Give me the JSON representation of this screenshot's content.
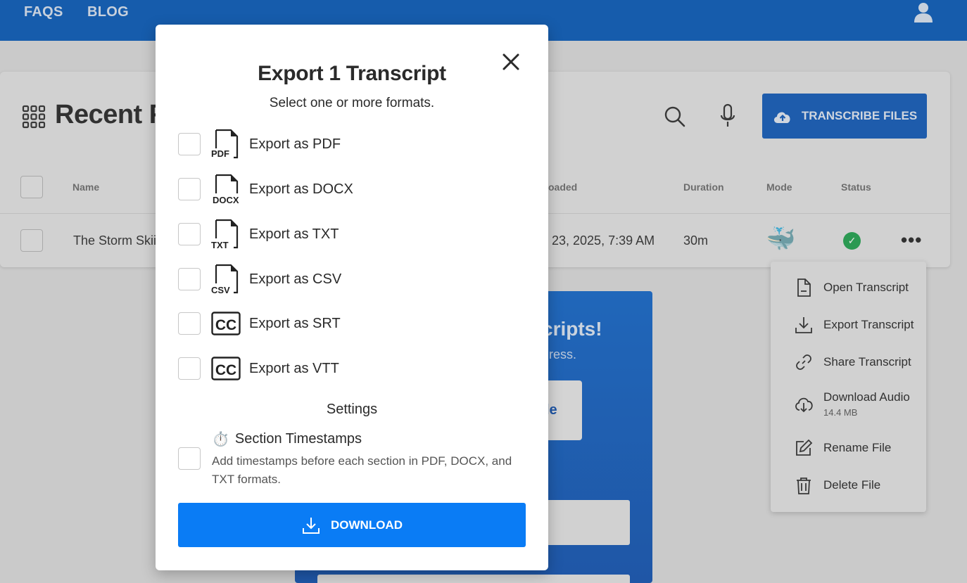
{
  "nav": {
    "faqs": "FAQS",
    "blog": "BLOG"
  },
  "background": {
    "recent_title": "Recent Fi",
    "transcribe_label": "TRANSCRIBE FILES",
    "columns": {
      "name": "Name",
      "uploaded": "oaded",
      "duration": "Duration",
      "mode": "Mode",
      "status": "Status"
    },
    "row": {
      "name": "The Storm Skiii",
      "uploaded": "23, 2025, 7:39 AM",
      "duration": "30m",
      "mode_icon": "🐳",
      "status_icon": "✓",
      "more": "•••"
    },
    "promo": {
      "title": "cripts!",
      "subtitle": "gress.",
      "button": "le"
    }
  },
  "context_menu": {
    "items": [
      {
        "label": "Open Transcript",
        "icon": "document-icon"
      },
      {
        "label": "Export Transcript",
        "icon": "download-icon"
      },
      {
        "label": "Share Transcript",
        "icon": "link-icon"
      },
      {
        "label": "Download Audio",
        "sub": "14.4 MB",
        "icon": "cloud-download-icon"
      },
      {
        "label": "Rename File",
        "icon": "edit-icon"
      },
      {
        "label": "Delete File",
        "icon": "trash-icon"
      }
    ]
  },
  "modal": {
    "title": "Export 1 Transcript",
    "subtitle": "Select one or more formats.",
    "formats": [
      {
        "label": "Export as PDF",
        "tag": "PDF"
      },
      {
        "label": "Export as DOCX",
        "tag": "DOCX"
      },
      {
        "label": "Export as TXT",
        "tag": "TXT"
      },
      {
        "label": "Export as CSV",
        "tag": "CSV"
      },
      {
        "label": "Export as SRT",
        "tag": "CC"
      },
      {
        "label": "Export as VTT",
        "tag": "CC"
      }
    ],
    "settings_title": "Settings",
    "timestamps": {
      "emoji": "⏱️",
      "title": "Section Timestamps",
      "description": "Add timestamps before each section in PDF, DOCX, and TXT formats."
    },
    "download_label": "DOWNLOAD"
  },
  "colors": {
    "nav_blue": "#0156b8",
    "download_blue": "#0a7cf5",
    "status_green": "#1aa04a"
  }
}
